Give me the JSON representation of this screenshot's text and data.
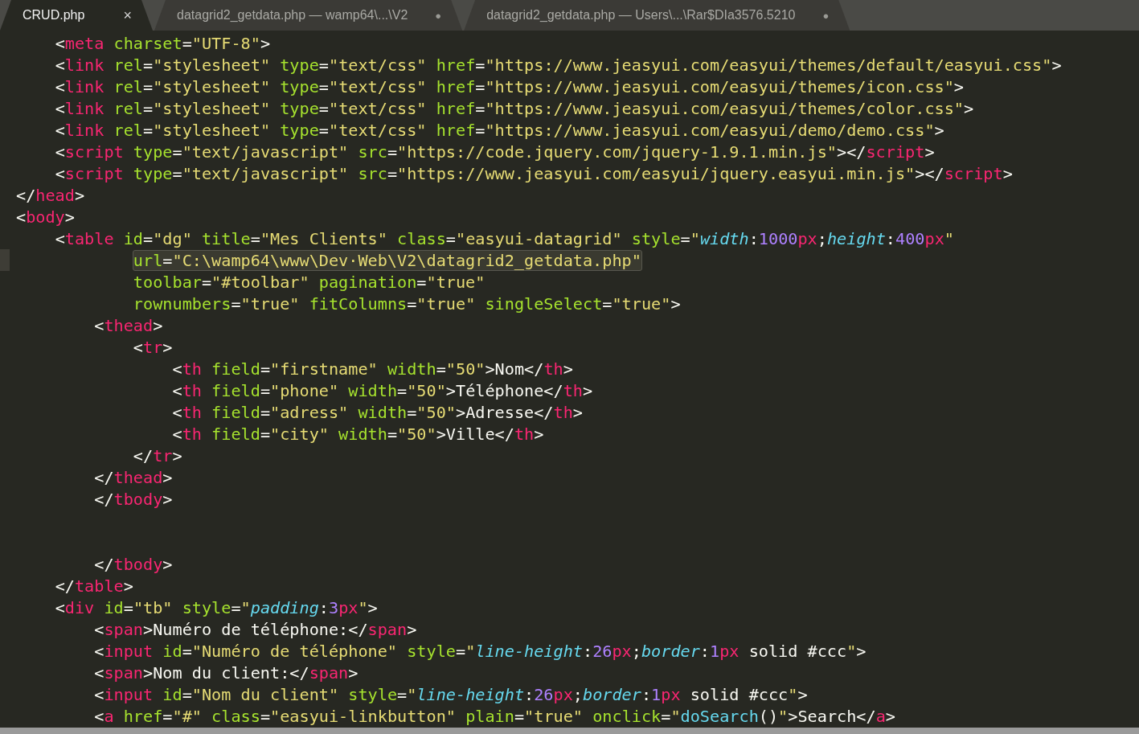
{
  "tabs": [
    {
      "label": "CRUD.php",
      "marker": "×",
      "selected": true
    },
    {
      "label": "datagrid2_getdata.php — wamp64\\...\\V2",
      "marker": "●",
      "selected": false
    },
    {
      "label": "datagrid2_getdata.php — Users\\...\\Rar$DIa3576.5210",
      "marker": "●",
      "selected": false
    }
  ],
  "lines": [
    {
      "current": false,
      "tokens": [
        {
          "kind": "p",
          "text": "    <"
        },
        {
          "kind": "t",
          "text": "meta"
        },
        {
          "kind": "a",
          "text": " charset"
        },
        {
          "kind": "p",
          "text": "="
        },
        {
          "kind": "s",
          "text": "\"UTF-8\""
        },
        {
          "kind": "p",
          "text": ">"
        }
      ]
    },
    {
      "current": false,
      "tokens": [
        {
          "kind": "p",
          "text": "    <"
        },
        {
          "kind": "t",
          "text": "link"
        },
        {
          "kind": "a",
          "text": " rel"
        },
        {
          "kind": "p",
          "text": "="
        },
        {
          "kind": "s",
          "text": "\"stylesheet\""
        },
        {
          "kind": "a",
          "text": " type"
        },
        {
          "kind": "p",
          "text": "="
        },
        {
          "kind": "s",
          "text": "\"text/css\""
        },
        {
          "kind": "a",
          "text": " href"
        },
        {
          "kind": "p",
          "text": "="
        },
        {
          "kind": "s",
          "text": "\"https://www.jeasyui.com/easyui/themes/default/easyui.css\""
        },
        {
          "kind": "p",
          "text": ">"
        }
      ]
    },
    {
      "current": false,
      "tokens": [
        {
          "kind": "p",
          "text": "    <"
        },
        {
          "kind": "t",
          "text": "link"
        },
        {
          "kind": "a",
          "text": " rel"
        },
        {
          "kind": "p",
          "text": "="
        },
        {
          "kind": "s",
          "text": "\"stylesheet\""
        },
        {
          "kind": "a",
          "text": " type"
        },
        {
          "kind": "p",
          "text": "="
        },
        {
          "kind": "s",
          "text": "\"text/css\""
        },
        {
          "kind": "a",
          "text": " href"
        },
        {
          "kind": "p",
          "text": "="
        },
        {
          "kind": "s",
          "text": "\"https://www.jeasyui.com/easyui/themes/icon.css\""
        },
        {
          "kind": "p",
          "text": ">"
        }
      ]
    },
    {
      "current": false,
      "tokens": [
        {
          "kind": "p",
          "text": "    <"
        },
        {
          "kind": "t",
          "text": "link"
        },
        {
          "kind": "a",
          "text": " rel"
        },
        {
          "kind": "p",
          "text": "="
        },
        {
          "kind": "s",
          "text": "\"stylesheet\""
        },
        {
          "kind": "a",
          "text": " type"
        },
        {
          "kind": "p",
          "text": "="
        },
        {
          "kind": "s",
          "text": "\"text/css\""
        },
        {
          "kind": "a",
          "text": " href"
        },
        {
          "kind": "p",
          "text": "="
        },
        {
          "kind": "s",
          "text": "\"https://www.jeasyui.com/easyui/themes/color.css\""
        },
        {
          "kind": "p",
          "text": ">"
        }
      ]
    },
    {
      "current": false,
      "tokens": [
        {
          "kind": "p",
          "text": "    <"
        },
        {
          "kind": "t",
          "text": "link"
        },
        {
          "kind": "a",
          "text": " rel"
        },
        {
          "kind": "p",
          "text": "="
        },
        {
          "kind": "s",
          "text": "\"stylesheet\""
        },
        {
          "kind": "a",
          "text": " type"
        },
        {
          "kind": "p",
          "text": "="
        },
        {
          "kind": "s",
          "text": "\"text/css\""
        },
        {
          "kind": "a",
          "text": " href"
        },
        {
          "kind": "p",
          "text": "="
        },
        {
          "kind": "s",
          "text": "\"https://www.jeasyui.com/easyui/demo/demo.css\""
        },
        {
          "kind": "p",
          "text": ">"
        }
      ]
    },
    {
      "current": false,
      "tokens": [
        {
          "kind": "p",
          "text": "    <"
        },
        {
          "kind": "t",
          "text": "script"
        },
        {
          "kind": "a",
          "text": " type"
        },
        {
          "kind": "p",
          "text": "="
        },
        {
          "kind": "s",
          "text": "\"text/javascript\""
        },
        {
          "kind": "a",
          "text": " src"
        },
        {
          "kind": "p",
          "text": "="
        },
        {
          "kind": "s",
          "text": "\"https://code.jquery.com/jquery-1.9.1.min.js\""
        },
        {
          "kind": "p",
          "text": "></"
        },
        {
          "kind": "t",
          "text": "script"
        },
        {
          "kind": "p",
          "text": ">"
        }
      ]
    },
    {
      "current": false,
      "tokens": [
        {
          "kind": "p",
          "text": "    <"
        },
        {
          "kind": "t",
          "text": "script"
        },
        {
          "kind": "a",
          "text": " type"
        },
        {
          "kind": "p",
          "text": "="
        },
        {
          "kind": "s",
          "text": "\"text/javascript\""
        },
        {
          "kind": "a",
          "text": " src"
        },
        {
          "kind": "p",
          "text": "="
        },
        {
          "kind": "s",
          "text": "\"https://www.jeasyui.com/easyui/jquery.easyui.min.js\""
        },
        {
          "kind": "p",
          "text": "></"
        },
        {
          "kind": "t",
          "text": "script"
        },
        {
          "kind": "p",
          "text": ">"
        }
      ]
    },
    {
      "current": false,
      "tokens": [
        {
          "kind": "p",
          "text": "</"
        },
        {
          "kind": "t",
          "text": "head"
        },
        {
          "kind": "p",
          "text": ">"
        }
      ]
    },
    {
      "current": false,
      "tokens": [
        {
          "kind": "p",
          "text": "<"
        },
        {
          "kind": "t",
          "text": "body"
        },
        {
          "kind": "p",
          "text": ">"
        }
      ]
    },
    {
      "current": false,
      "tokens": [
        {
          "kind": "p",
          "text": "    <"
        },
        {
          "kind": "t",
          "text": "table"
        },
        {
          "kind": "a",
          "text": " id"
        },
        {
          "kind": "p",
          "text": "="
        },
        {
          "kind": "s",
          "text": "\"dg\""
        },
        {
          "kind": "a",
          "text": " title"
        },
        {
          "kind": "p",
          "text": "="
        },
        {
          "kind": "s",
          "text": "\"Mes Clients\""
        },
        {
          "kind": "a",
          "text": " class"
        },
        {
          "kind": "p",
          "text": "="
        },
        {
          "kind": "s",
          "text": "\"easyui-datagrid\""
        },
        {
          "kind": "a",
          "text": " style"
        },
        {
          "kind": "p",
          "text": "="
        },
        {
          "kind": "s",
          "text": "\""
        },
        {
          "kind": "k",
          "text": "width"
        },
        {
          "kind": "p",
          "text": ":"
        },
        {
          "kind": "n",
          "text": "1000"
        },
        {
          "kind": "u",
          "text": "px"
        },
        {
          "kind": "p",
          "text": ";"
        },
        {
          "kind": "k",
          "text": "height"
        },
        {
          "kind": "p",
          "text": ":"
        },
        {
          "kind": "n",
          "text": "400"
        },
        {
          "kind": "u",
          "text": "px"
        },
        {
          "kind": "s",
          "text": "\""
        }
      ]
    },
    {
      "current": true,
      "tokens": [
        {
          "kind": "a",
          "text": "            url"
        },
        {
          "kind": "p",
          "text": "="
        },
        {
          "kind": "s",
          "text": "\"C:\\wamp64\\www\\Dev·Web\\V2\\datagrid2_getdata.php\""
        }
      ]
    },
    {
      "current": false,
      "tokens": [
        {
          "kind": "a",
          "text": "            toolbar"
        },
        {
          "kind": "p",
          "text": "="
        },
        {
          "kind": "s",
          "text": "\"#toolbar\""
        },
        {
          "kind": "a",
          "text": " pagination"
        },
        {
          "kind": "p",
          "text": "="
        },
        {
          "kind": "s",
          "text": "\"true\""
        }
      ]
    },
    {
      "current": false,
      "tokens": [
        {
          "kind": "a",
          "text": "            rownumbers"
        },
        {
          "kind": "p",
          "text": "="
        },
        {
          "kind": "s",
          "text": "\"true\""
        },
        {
          "kind": "a",
          "text": " fitColumns"
        },
        {
          "kind": "p",
          "text": "="
        },
        {
          "kind": "s",
          "text": "\"true\""
        },
        {
          "kind": "a",
          "text": " singleSelect"
        },
        {
          "kind": "p",
          "text": "="
        },
        {
          "kind": "s",
          "text": "\"true\""
        },
        {
          "kind": "p",
          "text": ">"
        }
      ]
    },
    {
      "current": false,
      "tokens": [
        {
          "kind": "p",
          "text": "        <"
        },
        {
          "kind": "t",
          "text": "thead"
        },
        {
          "kind": "p",
          "text": ">"
        }
      ]
    },
    {
      "current": false,
      "tokens": [
        {
          "kind": "p",
          "text": "            <"
        },
        {
          "kind": "t",
          "text": "tr"
        },
        {
          "kind": "p",
          "text": ">"
        }
      ]
    },
    {
      "current": false,
      "tokens": [
        {
          "kind": "p",
          "text": "                <"
        },
        {
          "kind": "t",
          "text": "th"
        },
        {
          "kind": "a",
          "text": " field"
        },
        {
          "kind": "p",
          "text": "="
        },
        {
          "kind": "s",
          "text": "\"firstname\""
        },
        {
          "kind": "a",
          "text": " width"
        },
        {
          "kind": "p",
          "text": "="
        },
        {
          "kind": "s",
          "text": "\"50\""
        },
        {
          "kind": "p",
          "text": ">Nom</"
        },
        {
          "kind": "t",
          "text": "th"
        },
        {
          "kind": "p",
          "text": ">"
        }
      ]
    },
    {
      "current": false,
      "tokens": [
        {
          "kind": "p",
          "text": "                <"
        },
        {
          "kind": "t",
          "text": "th"
        },
        {
          "kind": "a",
          "text": " field"
        },
        {
          "kind": "p",
          "text": "="
        },
        {
          "kind": "s",
          "text": "\"phone\""
        },
        {
          "kind": "a",
          "text": " width"
        },
        {
          "kind": "p",
          "text": "="
        },
        {
          "kind": "s",
          "text": "\"50\""
        },
        {
          "kind": "p",
          "text": ">Téléphone</"
        },
        {
          "kind": "t",
          "text": "th"
        },
        {
          "kind": "p",
          "text": ">"
        }
      ]
    },
    {
      "current": false,
      "tokens": [
        {
          "kind": "p",
          "text": "                <"
        },
        {
          "kind": "t",
          "text": "th"
        },
        {
          "kind": "a",
          "text": " field"
        },
        {
          "kind": "p",
          "text": "="
        },
        {
          "kind": "s",
          "text": "\"adress\""
        },
        {
          "kind": "a",
          "text": " width"
        },
        {
          "kind": "p",
          "text": "="
        },
        {
          "kind": "s",
          "text": "\"50\""
        },
        {
          "kind": "p",
          "text": ">Adresse</"
        },
        {
          "kind": "t",
          "text": "th"
        },
        {
          "kind": "p",
          "text": ">"
        }
      ]
    },
    {
      "current": false,
      "tokens": [
        {
          "kind": "p",
          "text": "                <"
        },
        {
          "kind": "t",
          "text": "th"
        },
        {
          "kind": "a",
          "text": " field"
        },
        {
          "kind": "p",
          "text": "="
        },
        {
          "kind": "s",
          "text": "\"city\""
        },
        {
          "kind": "a",
          "text": " width"
        },
        {
          "kind": "p",
          "text": "="
        },
        {
          "kind": "s",
          "text": "\"50\""
        },
        {
          "kind": "p",
          "text": ">Ville</"
        },
        {
          "kind": "t",
          "text": "th"
        },
        {
          "kind": "p",
          "text": ">"
        }
      ]
    },
    {
      "current": false,
      "tokens": [
        {
          "kind": "p",
          "text": "            </"
        },
        {
          "kind": "t",
          "text": "tr"
        },
        {
          "kind": "p",
          "text": ">"
        }
      ]
    },
    {
      "current": false,
      "tokens": [
        {
          "kind": "p",
          "text": "        </"
        },
        {
          "kind": "t",
          "text": "thead"
        },
        {
          "kind": "p",
          "text": ">"
        }
      ]
    },
    {
      "current": false,
      "tokens": [
        {
          "kind": "p",
          "text": "        </"
        },
        {
          "kind": "t",
          "text": "tbody"
        },
        {
          "kind": "p",
          "text": ">"
        }
      ]
    },
    {
      "current": false
    },
    {
      "current": false
    },
    {
      "current": false,
      "tokens": [
        {
          "kind": "p",
          "text": "        </"
        },
        {
          "kind": "t",
          "text": "tbody"
        },
        {
          "kind": "p",
          "text": ">"
        }
      ]
    },
    {
      "current": false,
      "tokens": [
        {
          "kind": "p",
          "text": "    </"
        },
        {
          "kind": "t",
          "text": "table"
        },
        {
          "kind": "p",
          "text": ">"
        }
      ]
    },
    {
      "current": false,
      "tokens": [
        {
          "kind": "p",
          "text": "    <"
        },
        {
          "kind": "t",
          "text": "div"
        },
        {
          "kind": "a",
          "text": " id"
        },
        {
          "kind": "p",
          "text": "="
        },
        {
          "kind": "s",
          "text": "\"tb\""
        },
        {
          "kind": "a",
          "text": " style"
        },
        {
          "kind": "p",
          "text": "="
        },
        {
          "kind": "s",
          "text": "\""
        },
        {
          "kind": "k",
          "text": "padding"
        },
        {
          "kind": "p",
          "text": ":"
        },
        {
          "kind": "n",
          "text": "3"
        },
        {
          "kind": "u",
          "text": "px"
        },
        {
          "kind": "s",
          "text": "\""
        },
        {
          "kind": "p",
          "text": ">"
        }
      ]
    },
    {
      "current": false,
      "tokens": [
        {
          "kind": "p",
          "text": "        <"
        },
        {
          "kind": "t",
          "text": "span"
        },
        {
          "kind": "p",
          "text": ">Numéro de téléphone:</"
        },
        {
          "kind": "t",
          "text": "span"
        },
        {
          "kind": "p",
          "text": ">"
        }
      ]
    },
    {
      "current": false,
      "tokens": [
        {
          "kind": "p",
          "text": "        <"
        },
        {
          "kind": "t",
          "text": "input"
        },
        {
          "kind": "a",
          "text": " id"
        },
        {
          "kind": "p",
          "text": "="
        },
        {
          "kind": "s",
          "text": "\"Numéro de téléphone\""
        },
        {
          "kind": "a",
          "text": " style"
        },
        {
          "kind": "p",
          "text": "="
        },
        {
          "kind": "s",
          "text": "\""
        },
        {
          "kind": "k",
          "text": "line-height"
        },
        {
          "kind": "p",
          "text": ":"
        },
        {
          "kind": "n",
          "text": "26"
        },
        {
          "kind": "u",
          "text": "px"
        },
        {
          "kind": "p",
          "text": ";"
        },
        {
          "kind": "k",
          "text": "border"
        },
        {
          "kind": "p",
          "text": ":"
        },
        {
          "kind": "n",
          "text": "1"
        },
        {
          "kind": "u",
          "text": "px"
        },
        {
          "kind": "p",
          "text": " solid #ccc"
        },
        {
          "kind": "s",
          "text": "\""
        },
        {
          "kind": "p",
          "text": ">"
        }
      ]
    },
    {
      "current": false,
      "tokens": [
        {
          "kind": "p",
          "text": "        <"
        },
        {
          "kind": "t",
          "text": "span"
        },
        {
          "kind": "p",
          "text": ">Nom du client:</"
        },
        {
          "kind": "t",
          "text": "span"
        },
        {
          "kind": "p",
          "text": ">"
        }
      ]
    },
    {
      "current": false,
      "tokens": [
        {
          "kind": "p",
          "text": "        <"
        },
        {
          "kind": "t",
          "text": "input"
        },
        {
          "kind": "a",
          "text": " id"
        },
        {
          "kind": "p",
          "text": "="
        },
        {
          "kind": "s",
          "text": "\"Nom du client\""
        },
        {
          "kind": "a",
          "text": " style"
        },
        {
          "kind": "p",
          "text": "="
        },
        {
          "kind": "s",
          "text": "\""
        },
        {
          "kind": "k",
          "text": "line-height"
        },
        {
          "kind": "p",
          "text": ":"
        },
        {
          "kind": "n",
          "text": "26"
        },
        {
          "kind": "u",
          "text": "px"
        },
        {
          "kind": "p",
          "text": ";"
        },
        {
          "kind": "k",
          "text": "border"
        },
        {
          "kind": "p",
          "text": ":"
        },
        {
          "kind": "n",
          "text": "1"
        },
        {
          "kind": "u",
          "text": "px"
        },
        {
          "kind": "p",
          "text": " solid #ccc"
        },
        {
          "kind": "s",
          "text": "\""
        },
        {
          "kind": "p",
          "text": ">"
        }
      ]
    },
    {
      "current": false,
      "tokens": [
        {
          "kind": "p",
          "text": "        <"
        },
        {
          "kind": "t",
          "text": "a"
        },
        {
          "kind": "a",
          "text": " href"
        },
        {
          "kind": "p",
          "text": "="
        },
        {
          "kind": "s",
          "text": "\"#\""
        },
        {
          "kind": "a",
          "text": " class"
        },
        {
          "kind": "p",
          "text": "="
        },
        {
          "kind": "s",
          "text": "\"easyui-linkbutton\""
        },
        {
          "kind": "a",
          "text": " plain"
        },
        {
          "kind": "p",
          "text": "="
        },
        {
          "kind": "s",
          "text": "\"true\""
        },
        {
          "kind": "a",
          "text": " onclick"
        },
        {
          "kind": "p",
          "text": "="
        },
        {
          "kind": "s",
          "text": "\""
        },
        {
          "kind": "f",
          "text": "doSearch"
        },
        {
          "kind": "p",
          "text": "()"
        },
        {
          "kind": "s",
          "text": "\""
        },
        {
          "kind": "p",
          "text": ">Search</"
        },
        {
          "kind": "t",
          "text": "a"
        },
        {
          "kind": "p",
          "text": ">"
        }
      ]
    }
  ]
}
